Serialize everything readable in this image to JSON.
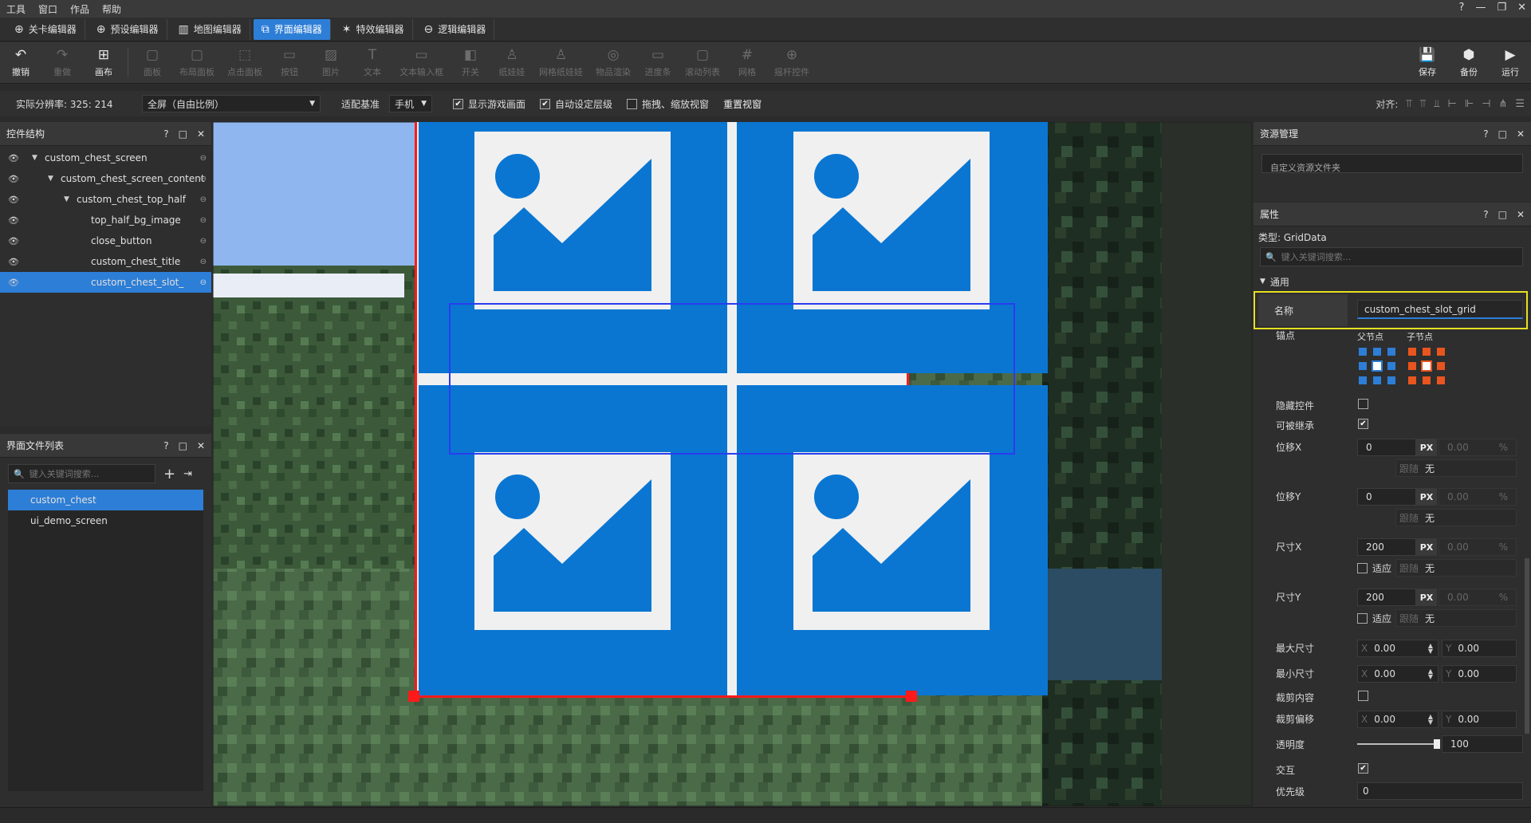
{
  "menu": {
    "items": [
      "工具",
      "窗口",
      "作品",
      "帮助"
    ]
  },
  "editor_tabs": [
    {
      "label": "关卡编辑器",
      "icon": "level-icon"
    },
    {
      "label": "预设编辑器",
      "icon": "preset-icon"
    },
    {
      "label": "地图编辑器",
      "icon": "map-icon"
    },
    {
      "label": "界面编辑器",
      "icon": "ui-icon",
      "active": true
    },
    {
      "label": "特效编辑器",
      "icon": "effect-icon"
    },
    {
      "label": "逻辑编辑器",
      "icon": "logic-icon"
    }
  ],
  "toolbar": {
    "undo": "撤销",
    "redo": "重做",
    "canvas": "画布",
    "panel": "面板",
    "layout_panel": "布局面板",
    "click_panel": "点击面板",
    "button": "按钮",
    "image": "图片",
    "text": "文本",
    "text_input": "文本输入框",
    "switch": "开关",
    "paper_doll": "纸娃娃",
    "grid_paper_doll": "网格纸娃娃",
    "item_render": "物品渲染",
    "progress_bar": "进度条",
    "scroll_list": "滚动列表",
    "grid": "网格",
    "stick_control": "摇杆控件",
    "save": "保存",
    "backup": "备份",
    "run": "运行"
  },
  "options": {
    "resolution_label": "实际分辨率: 325: 214",
    "screen_mode": "全屏（自由比例）",
    "fit_label": "适配基准",
    "device": "手机",
    "show_game": "显示游戏画面",
    "auto_layer": "自动设定层级",
    "drag_zoom": "拖拽、缩放视窗",
    "reset_view": "重置视窗",
    "align_label": "对齐:"
  },
  "control_tree": {
    "title": "控件结构",
    "items": [
      {
        "label": "custom_chest_screen",
        "depth": 0,
        "expanded": true
      },
      {
        "label": "custom_chest_screen_content",
        "depth": 1,
        "expanded": true
      },
      {
        "label": "custom_chest_top_half",
        "depth": 2,
        "expanded": true
      },
      {
        "label": "top_half_bg_image",
        "depth": 3
      },
      {
        "label": "close_button",
        "depth": 3
      },
      {
        "label": "custom_chest_title",
        "depth": 3
      },
      {
        "label": "custom_chest_slot_",
        "depth": 3,
        "selected": true
      }
    ]
  },
  "file_list": {
    "title": "界面文件列表",
    "search_placeholder": "键入关键词搜索...",
    "items": [
      {
        "label": "custom_chest",
        "selected": true
      },
      {
        "label": "ui_demo_screen"
      }
    ]
  },
  "resources": {
    "title": "资源管理",
    "search_placeholder": "自定义资源文件夹"
  },
  "properties": {
    "title": "属性",
    "type_label": "类型: GridData",
    "search_placeholder": "键入关键词搜索...",
    "section": "通用",
    "name_label": "名称",
    "name_value": "custom_chest_slot_grid",
    "anchor_label": "锚点",
    "anchor_parent": "父节点",
    "anchor_child": "子节点",
    "hide_label": "隐藏控件",
    "inherit_label": "可被继承",
    "pos_x_label": "位移X",
    "pos_y_label": "位移Y",
    "size_x_label": "尺寸X",
    "size_y_label": "尺寸Y",
    "pos_x": "0",
    "pos_y": "0",
    "size_x": "200",
    "size_y": "200",
    "px": "PX",
    "pct_value": "0.00",
    "pct": "%",
    "follow": "跟随",
    "none": "无",
    "fit": "适应",
    "max_size_label": "最大尺寸",
    "min_size_label": "最小尺寸",
    "clip_label": "裁剪内容",
    "clip_offset_label": "裁剪偏移",
    "alpha_label": "透明度",
    "interact_label": "交互",
    "priority_label": "优先级",
    "x": "X",
    "y": "Y",
    "zero": "0.00",
    "alpha_value": "100",
    "priority_value": "0"
  },
  "colors": {
    "accent": "#2d7ed6",
    "highlight": "#e6e020",
    "slot_blue": "#0a76d2",
    "selection_red": "#ff1a1a"
  }
}
